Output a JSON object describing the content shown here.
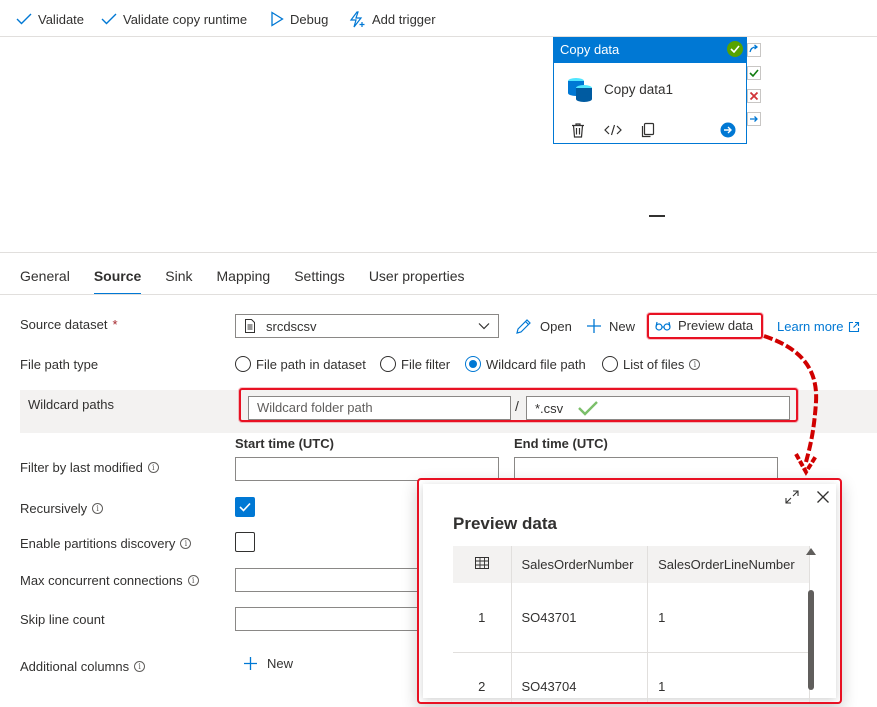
{
  "toolbar": {
    "validate": "Validate",
    "validate_copy_runtime": "Validate copy runtime",
    "debug": "Debug",
    "add_trigger": "Add trigger"
  },
  "activity": {
    "type": "Copy data",
    "name": "Copy data1"
  },
  "tabs": [
    "General",
    "Source",
    "Sink",
    "Mapping",
    "Settings",
    "User properties"
  ],
  "active_tab": "Source",
  "form": {
    "source_dataset_label": "Source dataset",
    "required_mark": "*",
    "dataset_value": "srcdscsv",
    "open_label": "Open",
    "new_label": "New",
    "preview_label": "Preview data",
    "learn_more": "Learn more",
    "file_path_type_label": "File path type",
    "radio_options": [
      "File path in dataset",
      "File filter",
      "Wildcard file path",
      "List of files"
    ],
    "radio_selected": "Wildcard file path",
    "wildcard_label": "Wildcard paths",
    "wildcard_folder_placeholder": "Wildcard folder path",
    "path_separator": "/",
    "wildcard_file_value": "*.csv",
    "start_time_label": "Start time (UTC)",
    "end_time_label": "End time (UTC)",
    "filter_label": "Filter by last modified",
    "recursively_label": "Recursively",
    "recursively_checked": true,
    "partitions_label": "Enable partitions discovery",
    "partitions_checked": false,
    "max_conn_label": "Max concurrent connections",
    "skip_label": "Skip line count",
    "additional_label": "Additional columns",
    "additional_new": "New"
  },
  "preview": {
    "title": "Preview data",
    "columns": [
      "SalesOrderNumber",
      "SalesOrderLineNumber"
    ],
    "rows": [
      {
        "index": "1",
        "SalesOrderNumber": "SO43701",
        "SalesOrderLineNumber": "1"
      },
      {
        "index": "2",
        "SalesOrderNumber": "SO43704",
        "SalesOrderLineNumber": "1"
      }
    ]
  },
  "colors": {
    "accent": "#0078d4",
    "success": "#57a300",
    "highlight": "#e81123"
  }
}
